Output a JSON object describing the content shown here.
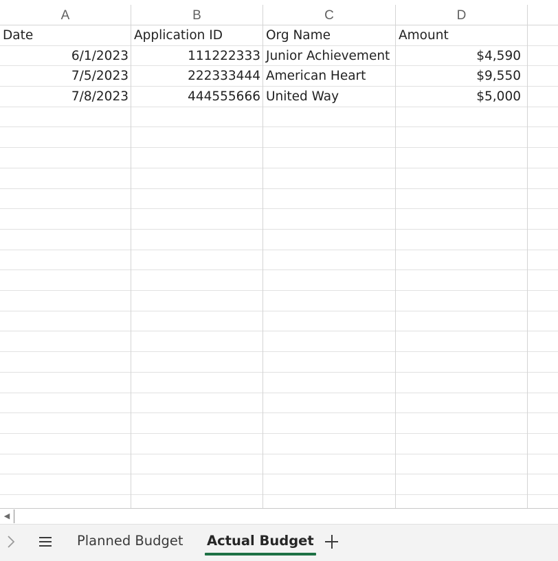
{
  "columns": [
    "A",
    "B",
    "C",
    "D"
  ],
  "rows": [
    [
      "Date",
      "Application ID",
      "Org Name",
      "Amount"
    ],
    [
      "6/1/2023",
      "111222333",
      "Junior Achievement",
      "$4,590"
    ],
    [
      "7/5/2023",
      "222333444",
      "American Heart",
      "$9,550"
    ],
    [
      "7/8/2023",
      "444555666",
      "United Way",
      "$5,000"
    ]
  ],
  "sheets": {
    "tabs": [
      {
        "label": "Planned Budget",
        "active": false
      },
      {
        "label": "Actual Budget",
        "active": true
      }
    ]
  },
  "icons": {
    "scroll_left": "scroll-left-arrow-icon",
    "chevron": "chevron-right-icon",
    "all_sheets": "hamburger-menu-icon",
    "add_sheet": "plus-icon"
  },
  "colors": {
    "active_tab_underline": "#1e7145",
    "gridline": "#d4d4d4",
    "tabbar_bg": "#f3f3f3"
  }
}
